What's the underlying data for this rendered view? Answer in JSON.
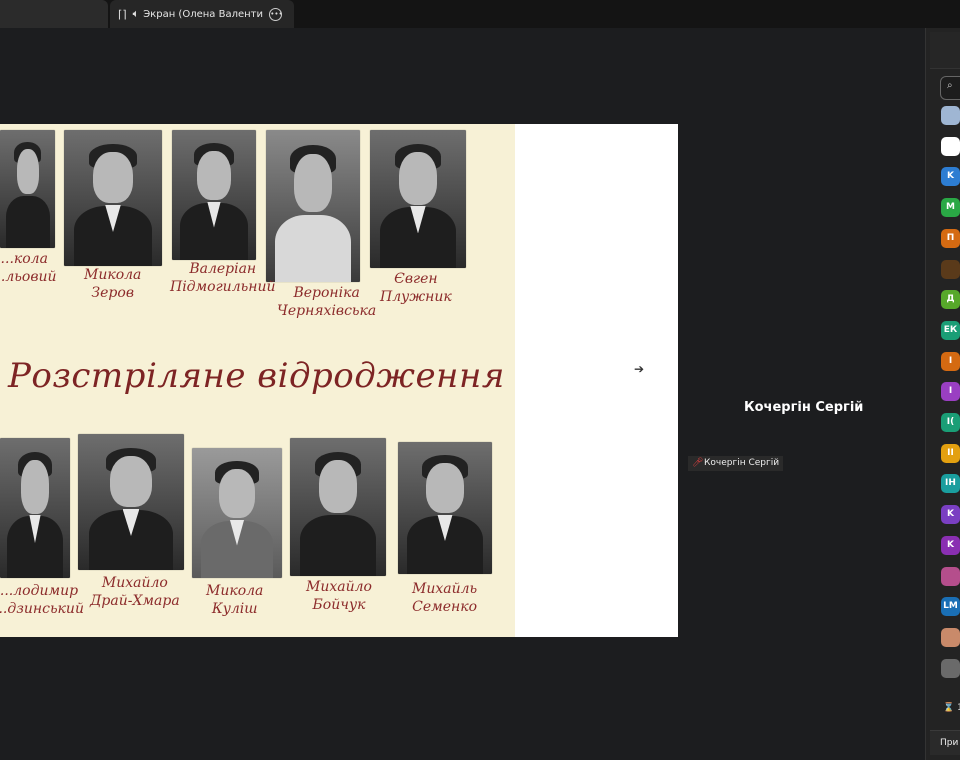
{
  "tab": {
    "title": "Экран (Олена Валентинівна",
    "share_icon": "screen-share-icon",
    "more_icon": "more-options-icon"
  },
  "slide": {
    "title": "Розстріляне відродження",
    "top_row": [
      {
        "name": "...кола\n...льовий"
      },
      {
        "name": "Микола\nЗеров"
      },
      {
        "name": "Валеріан\nПідмогильний"
      },
      {
        "name": "Вероніка\nЧерняхівська"
      },
      {
        "name": "Євген\nПлужник"
      }
    ],
    "bottom_row": [
      {
        "name": "...лодимир\n...дзинський"
      },
      {
        "name": "Михайло\nДрай-Хмара"
      },
      {
        "name": "Микола\nКуліш"
      },
      {
        "name": "Михайло\nБойчук"
      },
      {
        "name": "Михайль\nСеменко"
      }
    ]
  },
  "speaker": {
    "name": "Кочергін Сергій",
    "label": "Кочергін Сергій",
    "mic_icon": "mic-muted-icon"
  },
  "sidebar": {
    "search_icon": "search-icon",
    "participants": [
      {
        "initials": "",
        "color": "#9fb6d3"
      },
      {
        "initials": "",
        "color": "#ffffff"
      },
      {
        "initials": "K",
        "color": "#2d7dd2"
      },
      {
        "initials": "M",
        "color": "#2aa845"
      },
      {
        "initials": "П",
        "color": "#d46a12"
      },
      {
        "initials": "",
        "color": "#5a3a1a"
      },
      {
        "initials": "Д",
        "color": "#57a82a"
      },
      {
        "initials": "ЕК",
        "color": "#1a9e76"
      },
      {
        "initials": "I",
        "color": "#d46a12"
      },
      {
        "initials": "I",
        "color": "#9a3fc2"
      },
      {
        "initials": "I(",
        "color": "#1a9e76"
      },
      {
        "initials": "II",
        "color": "#e3a010"
      },
      {
        "initials": "IH",
        "color": "#1a9e9e"
      },
      {
        "initials": "K",
        "color": "#7a3fc2"
      },
      {
        "initials": "K",
        "color": "#8a2fb2"
      },
      {
        "initials": "",
        "color": "#b54e8c"
      },
      {
        "initials": "LM",
        "color": "#1a6fb5"
      },
      {
        "initials": "",
        "color": "#c98a6a"
      },
      {
        "initials": "",
        "color": "#6a6a6a"
      }
    ],
    "footer_count": "1",
    "footer_label": "При"
  }
}
